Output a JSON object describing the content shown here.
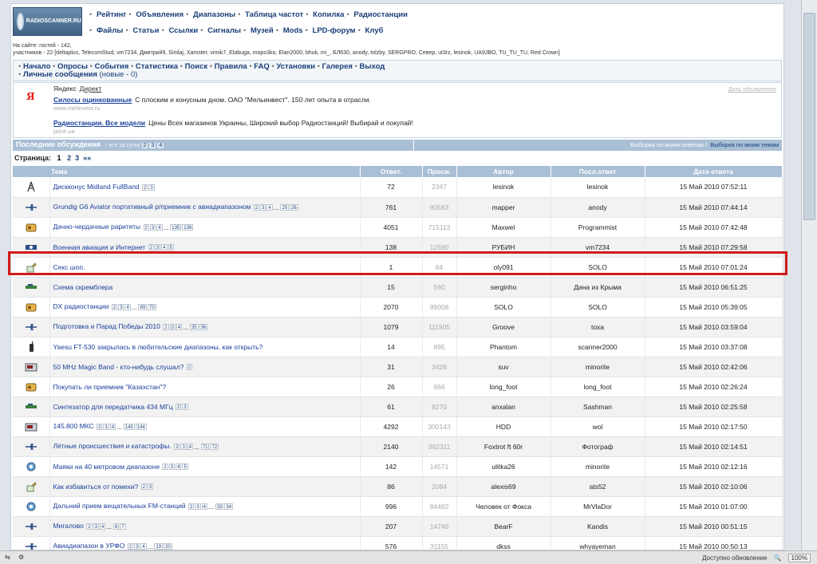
{
  "header": {
    "logo_text": "RADIOSCANNER.RU",
    "nav_row1": [
      "Рейтинг",
      "Объявления",
      "Диапазоны",
      "Таблица частот",
      "Копилка",
      "Радиостанции"
    ],
    "nav_row2": [
      "Файлы",
      "Статьи",
      "Ссылки",
      "Сигналы",
      "Музей",
      "Mods",
      "LPD-форум",
      "Клуб"
    ]
  },
  "online": {
    "line1": "На сайте: гостей - 142,",
    "line2": "участников - 22 [deltaplus, TelecomStud, vm7234, Дмитрий9, Sinilaj, Xamster, vimik7, Elabuga, mopo3ko, Elan2000, bhuk, mi_, БЛ630, anody, tolzby, SERGPRO, Север, ut3rz, lesinok, UA9JBO, TU_TU_TU, Red Crown]"
  },
  "menu": {
    "row1": [
      "Начало",
      "Опросы",
      "События",
      "Статистика",
      "Поиск",
      "Правила",
      "FAQ",
      "Установки",
      "Галерея",
      "Выход"
    ],
    "pm_label": "Личные сообщения",
    "pm_new": "(новые - 0)"
  },
  "ad": {
    "brand": "Яндекс",
    "direct": "Директ",
    "advertise": "Дать объявление",
    "items": [
      {
        "title": "Силосы оцинкованные",
        "text": "С плоским и конусным дном. ОАО \"Мельинвест\". 150 лет опыта в отрасли.",
        "url": "www.melinvest.ru"
      },
      {
        "title": "Радиостанции. Все модели",
        "text": "Цены Всех магазинов Украины, Широкий выбор Радиостанций! Выбирай и покупай!",
        "url": "price.ua"
      }
    ]
  },
  "discussions": {
    "title": "Последние обсуждения",
    "sub": "- все за сутки",
    "sub_pages": [
      "2",
      "3",
      "4"
    ],
    "right_label": "Выборка по моим ответам",
    "right_link": "Выборка по моим темам"
  },
  "pagination": {
    "label": "Страница:",
    "current": "1",
    "pages": [
      "2",
      "3",
      "»»"
    ]
  },
  "table": {
    "headers": [
      "Тема",
      "Ответ.",
      "Просм.",
      "Автор",
      "Посл.ответ",
      "Дата ответа"
    ],
    "rows": [
      {
        "icon": "antenna-icon",
        "title": "Дискконус Midland FullBand",
        "pages": [
          "2",
          "3"
        ],
        "replies": "72",
        "views": "2347",
        "author": "lesinok",
        "last": "lesinok",
        "date": "15 Май 2010 07:52:11"
      },
      {
        "icon": "plane-icon",
        "title": "Grundig G6 Aviator портативный р/приемник с авиадиапазоном",
        "pages": [
          "2",
          "3",
          "4",
          "...",
          "25",
          "26"
        ],
        "replies": "761",
        "views": "90583",
        "author": "mapper",
        "last": "anody",
        "date": "15 Май 2010 07:44:14"
      },
      {
        "icon": "radio-icon",
        "title": "Дачно-чердачные раритеты",
        "pages": [
          "2",
          "3",
          "4",
          "...",
          "135",
          "136"
        ],
        "replies": "4051",
        "views": "715113",
        "author": "Maxwel",
        "last": "Programmist",
        "date": "15 Май 2010 07:42:48"
      },
      {
        "icon": "satellite-icon",
        "title": "Военная авиация и Интернет",
        "pages": [
          "2",
          "3",
          "4",
          "5"
        ],
        "replies": "138",
        "views": "12590",
        "author": "РУБИН",
        "last": "vm7234",
        "date": "15 Май 2010 07:29:58"
      },
      {
        "icon": "note-icon",
        "title": "Секс шоп.",
        "pages": [],
        "replies": "1",
        "views": "84",
        "author": "oly091",
        "last": "SOLO",
        "date": "15 Май 2010 07:01:24"
      },
      {
        "icon": "circuit-icon",
        "title": "Схема скремблера",
        "pages": [],
        "replies": "15",
        "views": "590",
        "author": "serginho",
        "last": "Дина из Крыма",
        "date": "15 Май 2010 06:51:25"
      },
      {
        "icon": "radio-icon",
        "title": "DX радиостанции",
        "pages": [
          "2",
          "3",
          "4",
          "...",
          "69",
          "70"
        ],
        "replies": "2070",
        "views": "99008",
        "author": "SOLO",
        "last": "SOLO",
        "date": "15 Май 2010 05:39:05"
      },
      {
        "icon": "plane-icon",
        "title": "Подготовка и Парад Победы 2010",
        "pages": [
          "2",
          "3",
          "4",
          "...",
          "35",
          "36"
        ],
        "replies": "1079",
        "views": "111905",
        "author": "Groove",
        "last": "toxa",
        "date": "15 Май 2010 03:59:04"
      },
      {
        "icon": "walkie-talkie-icon",
        "title": "Yaesu FT-530 закрылась в любительские диапазоны, как открыть?",
        "pages": [],
        "replies": "14",
        "views": "895",
        "author": "Phantom",
        "last": "scanner2000",
        "date": "15 Май 2010 03:37:08"
      },
      {
        "icon": "receiver-icon",
        "title": "50 MHz Magic Band - кто-нибудь слушал?",
        "pages": [
          "2"
        ],
        "replies": "31",
        "views": "3426",
        "author": "suv",
        "last": "minorite",
        "date": "15 Май 2010 02:42:06"
      },
      {
        "icon": "radio-icon",
        "title": "Покупать ли приемник \"Казахстан\"?",
        "pages": [],
        "replies": "26",
        "views": "666",
        "author": "long_foot",
        "last": "long_foot",
        "date": "15 Май 2010 02:26:24"
      },
      {
        "icon": "circuit-icon",
        "title": "Синтезатор для передатчика 434 МГц",
        "pages": [
          "2",
          "3"
        ],
        "replies": "61",
        "views": "8270",
        "author": "anxalan",
        "last": "Sashman",
        "date": "15 Май 2010 02:25:58"
      },
      {
        "icon": "receiver-icon",
        "title": "145.800 МКС",
        "pages": [
          "2",
          "3",
          "4",
          "...",
          "143",
          "144"
        ],
        "replies": "4292",
        "views": "300143",
        "author": "HDD",
        "last": "wol",
        "date": "15 Май 2010 02:17:50"
      },
      {
        "icon": "plane-icon",
        "title": "Лётные происшествия и катастрофы.",
        "pages": [
          "2",
          "3",
          "4",
          "...",
          "71",
          "72"
        ],
        "replies": "2140",
        "views": "362311",
        "author": "Foxtrot ft 60r",
        "last": "Фотограф",
        "date": "15 Май 2010 02:14:51"
      },
      {
        "icon": "beacon-icon",
        "title": "Маяки на 40 метровом диапазоне",
        "pages": [
          "2",
          "3",
          "4",
          "5"
        ],
        "replies": "142",
        "views": "14571",
        "author": "ulitka26",
        "last": "minorite",
        "date": "15 Май 2010 02:12:16"
      },
      {
        "icon": "note-icon",
        "title": "Как избавиться от помехи?",
        "pages": [
          "2",
          "3"
        ],
        "replies": "86",
        "views": "2084",
        "author": "alexis69",
        "last": "ats52",
        "date": "15 Май 2010 02:10:06"
      },
      {
        "icon": "beacon-icon",
        "title": "Дальний прием вещательных FM-станций",
        "pages": [
          "2",
          "3",
          "4",
          "...",
          "33",
          "34"
        ],
        "replies": "996",
        "views": "84482",
        "author": "Человек от Фокса",
        "last": "MrVlaDor",
        "date": "15 Май 2010 01:07:00"
      },
      {
        "icon": "plane-icon",
        "title": "Мигалово",
        "pages": [
          "2",
          "3",
          "4",
          "...",
          "6",
          "7"
        ],
        "replies": "207",
        "views": "14746",
        "author": "BearF",
        "last": "Kandis",
        "date": "15 Май 2010 00:51:15"
      },
      {
        "icon": "plane-icon",
        "title": "Авиадиапазон в УРФО",
        "pages": [
          "2",
          "3",
          "4",
          "...",
          "19",
          "20"
        ],
        "replies": "576",
        "views": "31155",
        "author": "dkss",
        "last": "whyayeman",
        "date": "15 Май 2010 00:50:13"
      }
    ]
  },
  "statusbar": {
    "right_text": "Доступно обновление",
    "zoom": "100%"
  }
}
